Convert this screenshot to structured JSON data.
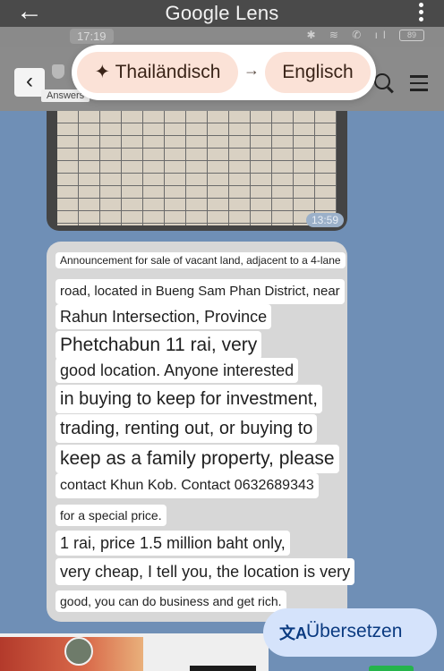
{
  "lens": {
    "title": "Google Lens",
    "back_icon": "arrow-left-icon",
    "more_icon": "more-vertical-icon"
  },
  "status_bar": {
    "time": "17:19",
    "battery": "89"
  },
  "chat_header": {
    "back_icon": "chevron-left-icon",
    "answers_label": "Answers"
  },
  "language_switch": {
    "source": "Thailändisch",
    "source_icon": "sparkle-icon",
    "arrow": "→",
    "target": "Englisch"
  },
  "messages": {
    "image_time": "13:59",
    "lines": [
      "Announcement for sale of vacant land, adjacent to a 4-lane",
      "road, located in Bueng Sam Phan District, near",
      "Rahun Intersection, Province",
      "Phetchabun 11 rai, very",
      "good location. Anyone interested",
      "in buying to keep for investment,",
      "trading, renting out, or buying to",
      "keep as a family property, please",
      "contact Khun Kob. Contact 0632689343",
      "for a special price.",
      "1 rai, price 1.5 million baht only,",
      "very cheap, I tell you, the location is very",
      "good, you can do business and get rich."
    ]
  },
  "translate_button": {
    "icon": "translate-icon",
    "icon_glyph": "文A",
    "label": "Übersetzen"
  },
  "colors": {
    "chat_background": "#6f8fb6",
    "chip": "#fbe2d7",
    "translate_button": "#d5e3fb"
  }
}
